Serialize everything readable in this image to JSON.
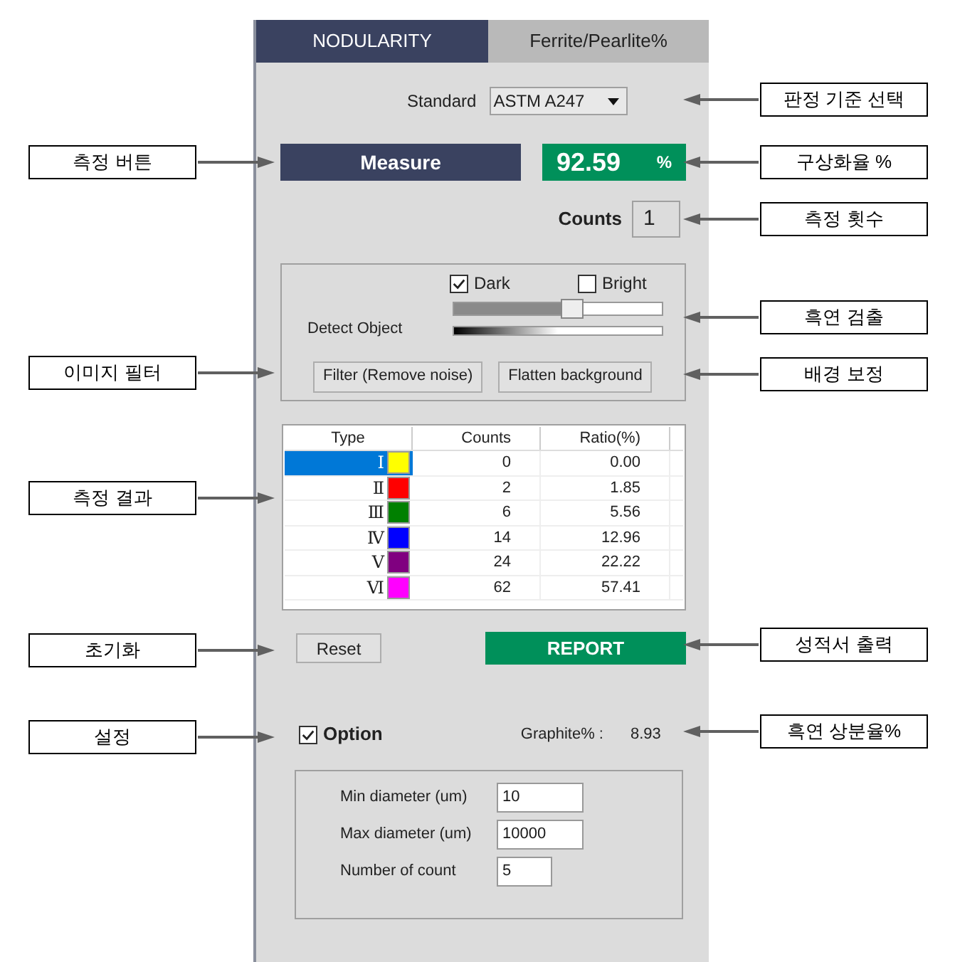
{
  "tabs": [
    {
      "label": "NODULARITY",
      "selected": true
    },
    {
      "label": "Ferrite/Pearlite%",
      "selected": false
    }
  ],
  "standard": {
    "label": "Standard",
    "value": "ASTM A247"
  },
  "measure_button": "Measure",
  "nodularity": {
    "value": "92.59",
    "unit": "%"
  },
  "counts": {
    "label": "Counts",
    "value": "1"
  },
  "detect": {
    "label": "Detect Object",
    "options": [
      {
        "label": "Dark",
        "checked": true
      },
      {
        "label": "Bright",
        "checked": false
      }
    ],
    "level": 0.57
  },
  "filter_buttons": [
    "Filter (Remove noise)",
    "Flatten background"
  ],
  "table": {
    "columns": [
      "Type",
      "Counts",
      "Ratio(%)"
    ],
    "rows": [
      {
        "type": "Ⅰ",
        "color": "#ffff00",
        "counts": "0",
        "ratio": "0.00",
        "selected": true
      },
      {
        "type": "Ⅱ",
        "color": "#ff0000",
        "counts": "2",
        "ratio": "1.85",
        "selected": false
      },
      {
        "type": "Ⅲ",
        "color": "#008000",
        "counts": "6",
        "ratio": "5.56",
        "selected": false
      },
      {
        "type": "Ⅳ",
        "color": "#0000ff",
        "counts": "14",
        "ratio": "12.96",
        "selected": false
      },
      {
        "type": "Ⅴ",
        "color": "#800080",
        "counts": "24",
        "ratio": "22.22",
        "selected": false
      },
      {
        "type": "Ⅵ",
        "color": "#ff00ff",
        "counts": "62",
        "ratio": "57.41",
        "selected": false
      }
    ]
  },
  "reset_button": "Reset",
  "report_button": "REPORT",
  "option": {
    "label": "Option",
    "checked": true
  },
  "graphite": {
    "label": "Graphite% :",
    "value": "8.93"
  },
  "option_fields": [
    {
      "label": "Min diameter (um)",
      "value": "10"
    },
    {
      "label": "Max diameter (um)",
      "value": "10000"
    },
    {
      "label": "Number of count",
      "value": "5"
    }
  ],
  "callouts_left": [
    "측정 버튼",
    "이미지 필터",
    "측정 결과",
    "초기화",
    "설정"
  ],
  "callouts_right": [
    "판정 기준 선택",
    "구상화율 %",
    "측정 횟수",
    "흑연 검출",
    "배경 보정",
    "성적서 출력",
    "흑연 상분율%"
  ]
}
